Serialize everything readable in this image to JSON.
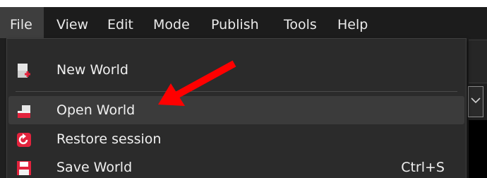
{
  "menubar": {
    "items": [
      {
        "label": "File",
        "active": true
      },
      {
        "label": "View",
        "active": false
      },
      {
        "label": "Edit",
        "active": false
      },
      {
        "label": "Mode",
        "active": false
      },
      {
        "label": "Publish",
        "active": false
      },
      {
        "label": "Tools",
        "active": false
      },
      {
        "label": "Help",
        "active": false
      }
    ]
  },
  "file_menu": {
    "items": [
      {
        "label": "New World",
        "icon": "new-world-icon",
        "shortcut": ""
      },
      {
        "label": "Open World",
        "icon": "open-world-icon",
        "shortcut": "",
        "highlighted": true
      },
      {
        "label": "Restore session",
        "icon": "restore-session-icon",
        "shortcut": ""
      },
      {
        "label": "Save World",
        "icon": "save-world-icon",
        "shortcut": "Ctrl+S"
      }
    ]
  },
  "colors": {
    "menubar_bg": "#1c1c1c",
    "menu_bg": "#2b2b2b",
    "hover_bg": "#3b3b3b",
    "text": "#f0f0f0",
    "icon_red": "#e3233d",
    "annotation_arrow": "#ff0000"
  }
}
